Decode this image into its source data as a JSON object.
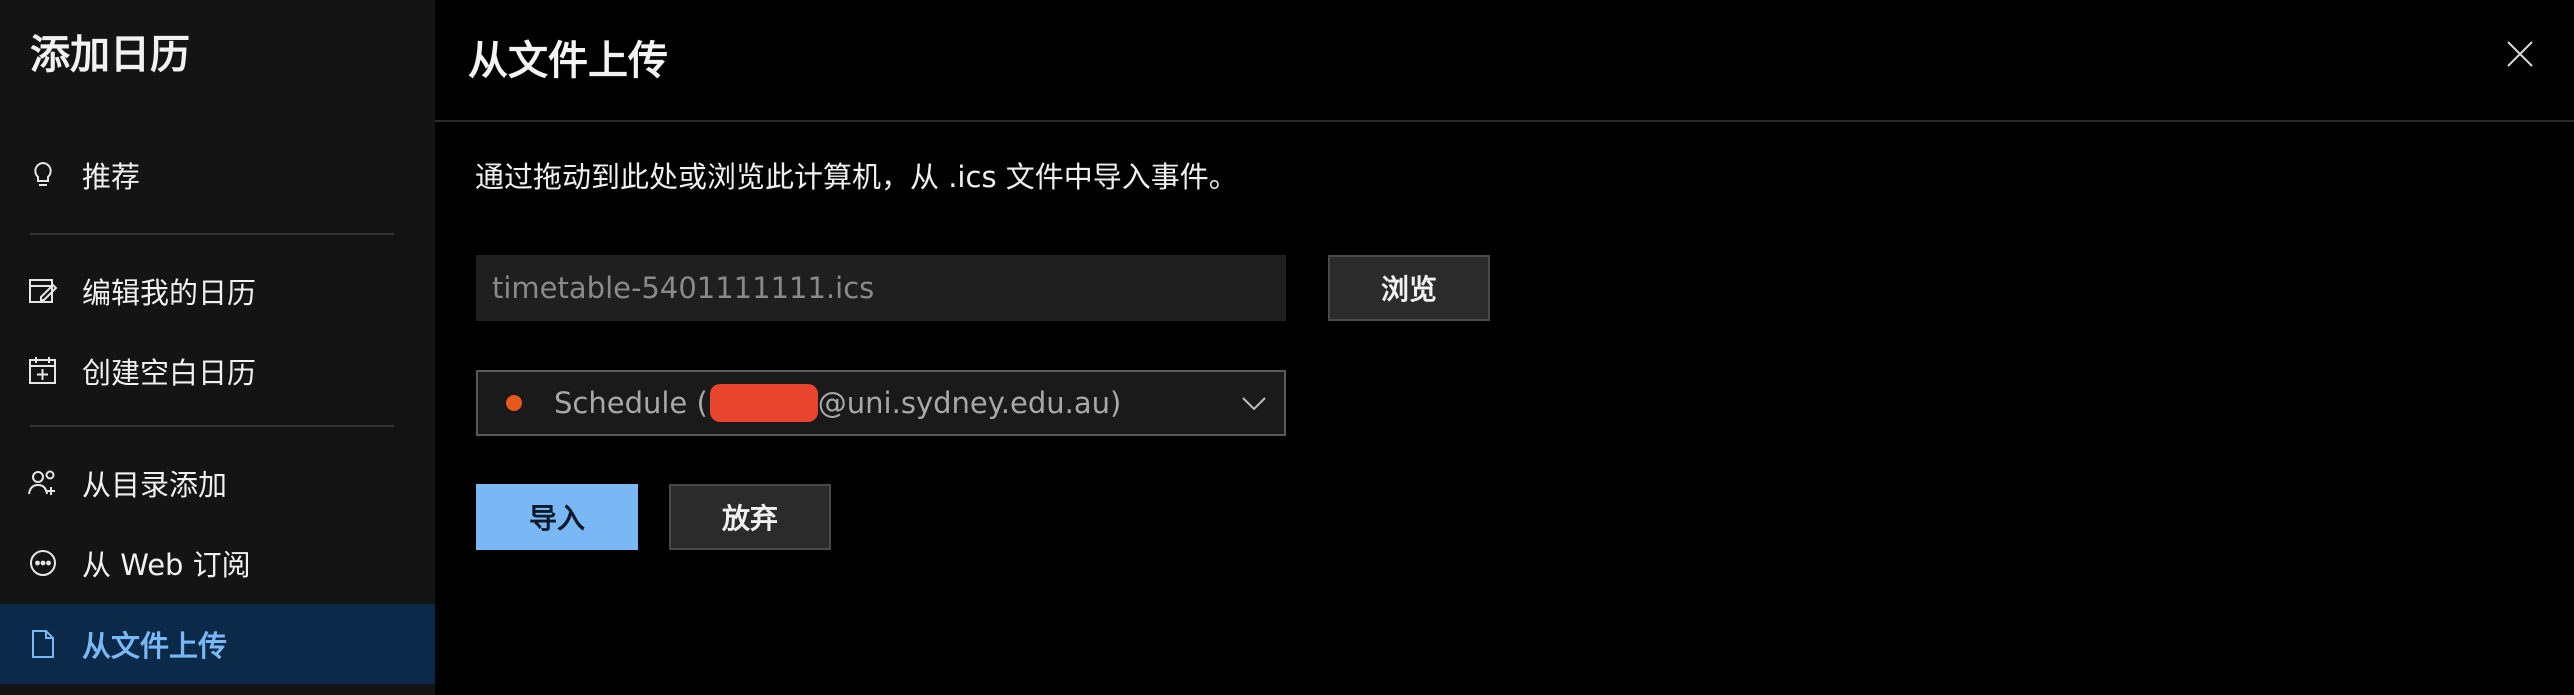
{
  "sidebar": {
    "title": "添加日历",
    "items": [
      {
        "label": "推荐",
        "icon": "lightbulb-icon"
      },
      {
        "label": "编辑我的日历",
        "icon": "edit-calendar-icon"
      },
      {
        "label": "创建空白日历",
        "icon": "add-calendar-icon"
      },
      {
        "label": "从目录添加",
        "icon": "people-add-icon"
      },
      {
        "label": "从 Web 订阅",
        "icon": "link-circle-icon"
      },
      {
        "label": "从文件上传",
        "icon": "file-upload-icon"
      }
    ]
  },
  "header": {
    "title": "从文件上传",
    "close_icon": "close-icon"
  },
  "main": {
    "description": "通过拖动到此处或浏览此计算机，从 .ics 文件中导入事件。",
    "file_input_placeholder": "timetable-5401111111.ics",
    "browse_label": "浏览",
    "calendar_select": {
      "prefix": "Schedule (",
      "suffix": "@uni.sydney.edu.au)",
      "dot_color": "#e8581c"
    },
    "import_label": "导入",
    "discard_label": "放弃"
  },
  "colors": {
    "accent": "#7ab8f5",
    "active_bg": "#0b2a49",
    "redaction": "#e8442e"
  }
}
